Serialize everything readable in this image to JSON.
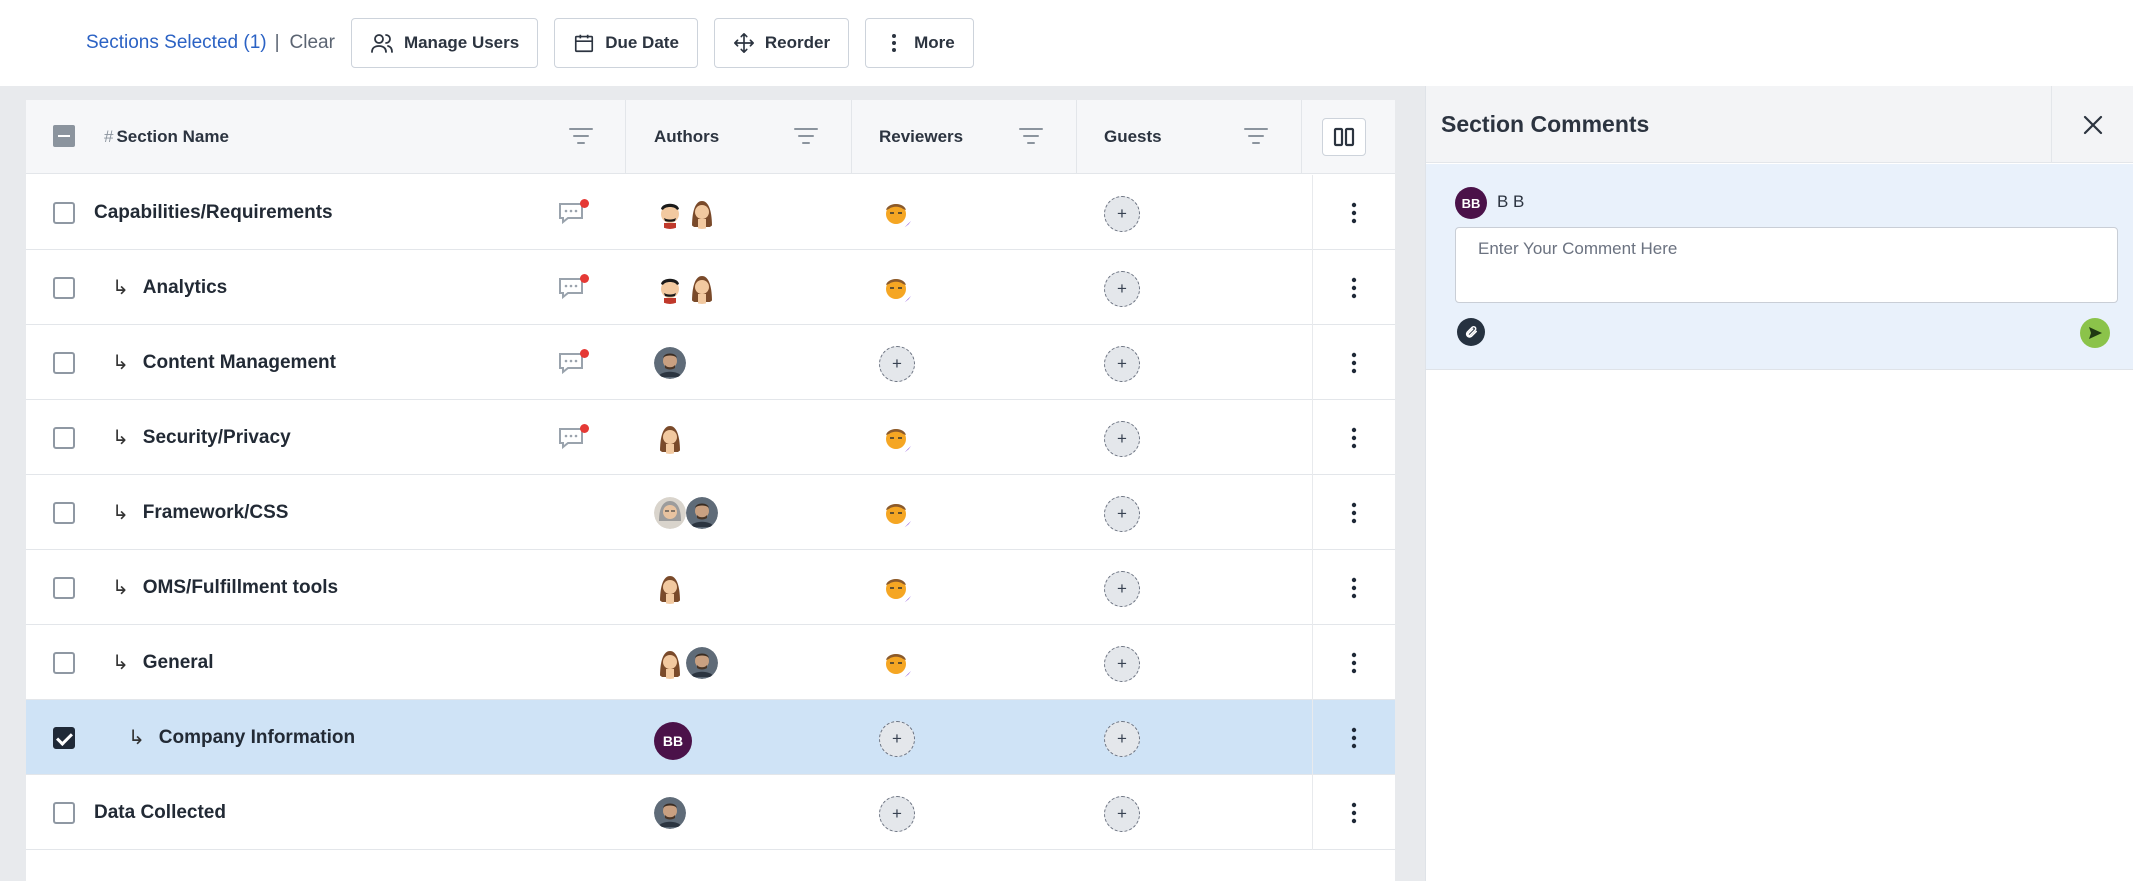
{
  "toolbar": {
    "selection_text": "Sections Selected (1)",
    "separator": "|",
    "clear_label": "Clear",
    "buttons": [
      {
        "label": "Manage Users",
        "icon": "users-icon"
      },
      {
        "label": "Due Date",
        "icon": "calendar-icon"
      },
      {
        "label": "Reorder",
        "icon": "move-icon"
      },
      {
        "label": "More",
        "icon": "more-vertical-icon"
      }
    ]
  },
  "grid": {
    "columns": {
      "hash": "#",
      "section_name": "Section Name",
      "authors": "Authors",
      "reviewers": "Reviewers",
      "guests": "Guests"
    },
    "add_symbol": "+",
    "rows": [
      {
        "name": "Capabilities/Requirements",
        "level": 0,
        "has_comments": true,
        "authors": [
          "avatar-man-mustache",
          "avatar-woman"
        ],
        "reviewers": [
          "avatar-man-yellow"
        ],
        "guests": [],
        "selected": false
      },
      {
        "name": "Analytics",
        "level": 1,
        "has_comments": true,
        "authors": [
          "avatar-man-mustache",
          "avatar-woman"
        ],
        "reviewers": [
          "avatar-man-yellow"
        ],
        "guests": [],
        "selected": false
      },
      {
        "name": "Content Management",
        "level": 1,
        "has_comments": true,
        "authors": [
          "avatar-photo-man"
        ],
        "reviewers": [],
        "guests": [],
        "selected": false
      },
      {
        "name": "Security/Privacy",
        "level": 1,
        "has_comments": true,
        "authors": [
          "avatar-woman"
        ],
        "reviewers": [
          "avatar-man-yellow"
        ],
        "guests": [],
        "selected": false
      },
      {
        "name": "Framework/CSS",
        "level": 1,
        "has_comments": false,
        "authors": [
          "avatar-older-woman",
          "avatar-photo-man"
        ],
        "reviewers": [
          "avatar-man-yellow"
        ],
        "guests": [],
        "selected": false
      },
      {
        "name": "OMS/Fulfillment tools",
        "level": 1,
        "has_comments": false,
        "authors": [
          "avatar-woman"
        ],
        "reviewers": [
          "avatar-man-yellow"
        ],
        "guests": [],
        "selected": false
      },
      {
        "name": "General",
        "level": 1,
        "has_comments": false,
        "authors": [
          "avatar-woman",
          "avatar-photo-man"
        ],
        "reviewers": [
          "avatar-man-yellow"
        ],
        "guests": [],
        "selected": false
      },
      {
        "name": "Company Information",
        "level": 2,
        "has_comments": false,
        "authors": [
          "initials-BB"
        ],
        "reviewers": [],
        "guests": [],
        "selected": true
      },
      {
        "name": "Data Collected",
        "level": 0,
        "has_comments": false,
        "authors": [
          "avatar-photo-man"
        ],
        "reviewers": [],
        "guests": [],
        "selected": false
      }
    ],
    "initials": "BB"
  },
  "comments_panel": {
    "title": "Section Comments",
    "user_initials": "BB",
    "user_name": "B B",
    "comment_placeholder": "Enter Your Comment Here"
  },
  "colors": {
    "accent_blue": "#2b62c4",
    "selected_row": "#cfe3f6",
    "avatar_bb": "#4b1249",
    "notification_dot": "#e53935",
    "send_green": "#8bc34a",
    "reviewer_badge": "#6d28d9"
  }
}
